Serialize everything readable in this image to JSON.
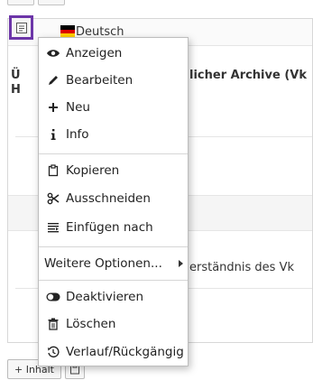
{
  "background": {
    "language_label": "Deutsch",
    "text_line_1": "Ü",
    "text_line_1b": "licher Archive (Vk",
    "text_line_2": "H",
    "text_line_3": "erständnis des Vk",
    "bottom_button": "+ Inhalt"
  },
  "context_menu": {
    "items": [
      {
        "label": "Anzeigen",
        "icon": "eye-icon"
      },
      {
        "label": "Bearbeiten",
        "icon": "pencil-icon"
      },
      {
        "label": "Neu",
        "icon": "plus-icon"
      },
      {
        "label": "Info",
        "icon": "info-icon"
      },
      {
        "label": "Kopieren",
        "icon": "copy-icon"
      },
      {
        "label": "Ausschneiden",
        "icon": "scissors-icon"
      },
      {
        "label": "Einfügen nach",
        "icon": "paste-after-icon"
      },
      {
        "label": "Weitere Optionen...",
        "icon": "submenu-arrow-icon"
      },
      {
        "label": "Deaktivieren",
        "icon": "toggle-icon"
      },
      {
        "label": "Löschen",
        "icon": "trash-icon"
      },
      {
        "label": "Verlauf/Rückgängig",
        "icon": "history-icon"
      }
    ]
  },
  "colors": {
    "highlight": "#6c35a8",
    "menu_border": "#bdbdbd",
    "separator": "#d6d6d6"
  }
}
